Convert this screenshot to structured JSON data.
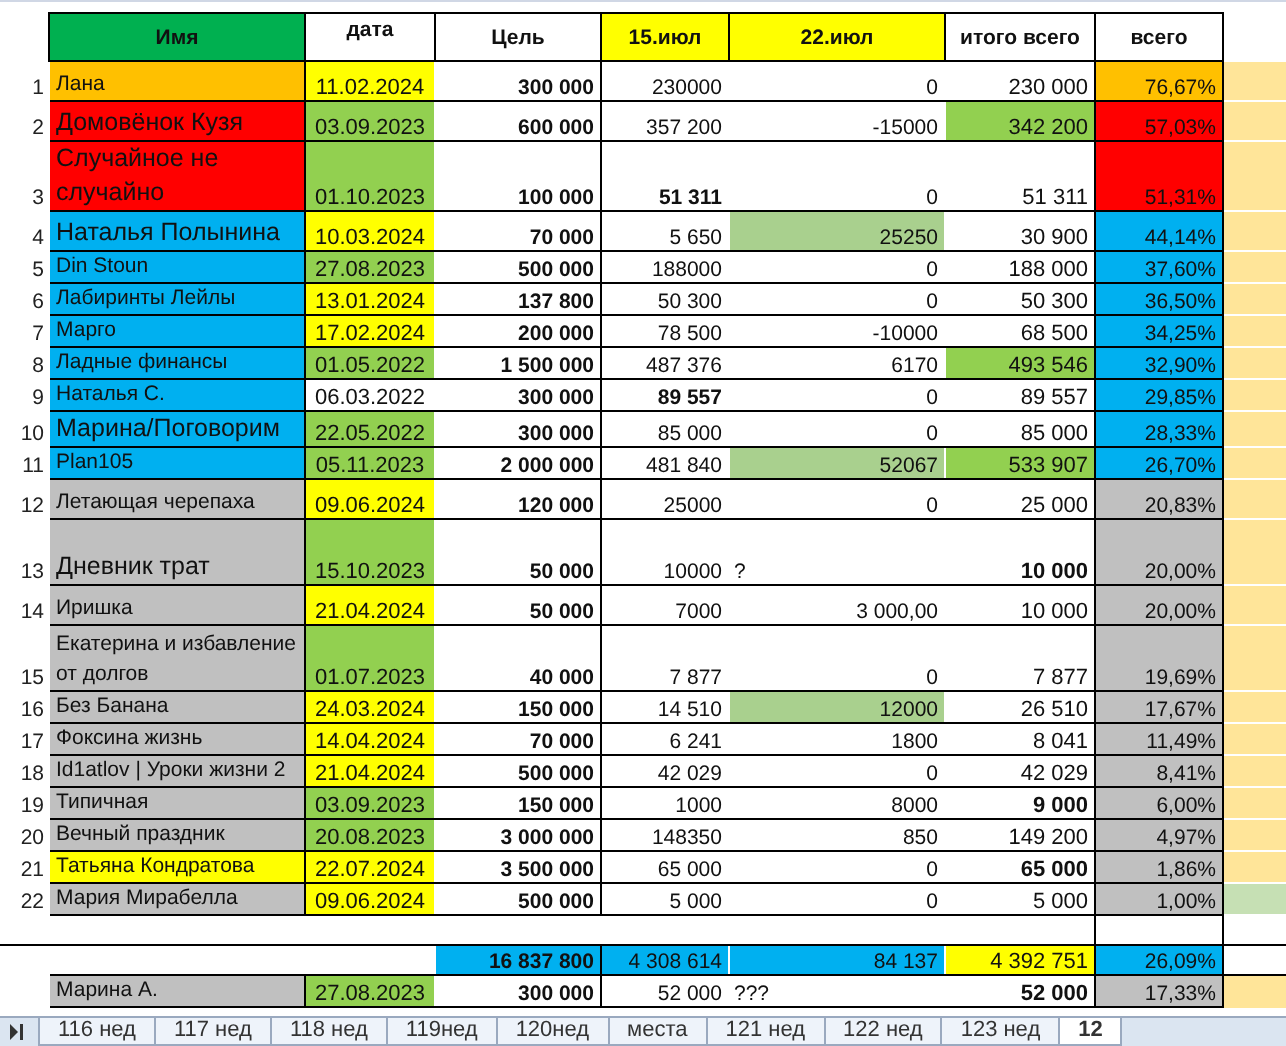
{
  "columns": [
    {
      "label": "Имя",
      "color": "#00b050"
    },
    {
      "label": "дата",
      "color": "#ffffff"
    },
    {
      "label": "Цель",
      "color": "#ffffff"
    },
    {
      "label": "15.июл",
      "color": "#ffff00"
    },
    {
      "label": "22.июл",
      "color": "#ffff00"
    },
    {
      "label": "итого всего",
      "color": "#ffffff"
    },
    {
      "label": "всего",
      "color": "#ffffff"
    }
  ],
  "rows": [
    {
      "num": "1",
      "name": {
        "text": "Лана",
        "color": "#ffc000",
        "large": false
      },
      "date": {
        "text": "11.02.2024",
        "color": "#ffff00"
      },
      "goal": "300 000",
      "w15": {
        "text": "230000",
        "bold": false
      },
      "w22": {
        "text": "0"
      },
      "total": {
        "text": "230 000",
        "bold": false
      },
      "pct": {
        "text": "76,67%",
        "color": "#ffc000"
      },
      "extra": {
        "color": "#ffe599"
      }
    },
    {
      "num": "2",
      "name": {
        "text": "Домовёнок Кузя",
        "color": "#ff0000",
        "large": true
      },
      "date": {
        "text": "03.09.2023",
        "color": "#92d050"
      },
      "goal": "600 000",
      "w15": {
        "text": "357 200",
        "bold": false
      },
      "w22": {
        "text": "-15000"
      },
      "total": {
        "text": "342 200",
        "color": "#92d050",
        "bold": false
      },
      "pct": {
        "text": "57,03%",
        "color": "#ff0000"
      },
      "extra": {
        "color": "#ffe599"
      }
    },
    {
      "num": "3",
      "name": {
        "text": "Случайное не случайно",
        "color": "#ff0000",
        "large": true
      },
      "date": {
        "text": "01.10.2023",
        "color": "#92d050"
      },
      "goal": "100 000",
      "w15": {
        "text": "51 311",
        "bold": true
      },
      "w22": {
        "text": "0"
      },
      "total": {
        "text": "51 311",
        "bold": false
      },
      "pct": {
        "text": "51,31%",
        "color": "#ff0000"
      },
      "extra": {
        "color": "#ffe599"
      }
    },
    {
      "num": "4",
      "name": {
        "text": "Наталья Полынина",
        "color": "#00b0f0",
        "large": true
      },
      "date": {
        "text": "10.03.2024",
        "color": "#ffff00"
      },
      "goal": "70 000",
      "w15": {
        "text": "5 650",
        "bold": false
      },
      "w22": {
        "text": "25250",
        "color": "#a9d08e"
      },
      "total": {
        "text": "30 900",
        "bold": false
      },
      "pct": {
        "text": "44,14%",
        "color": "#00b0f0"
      },
      "extra": {
        "color": "#ffe599"
      }
    },
    {
      "num": "5",
      "name": {
        "text": "Din Stoun",
        "color": "#00b0f0",
        "large": false
      },
      "date": {
        "text": "27.08.2023",
        "color": "#92d050"
      },
      "goal": "500 000",
      "w15": {
        "text": "188000",
        "bold": false
      },
      "w22": {
        "text": "0"
      },
      "total": {
        "text": "188 000",
        "bold": false
      },
      "pct": {
        "text": "37,60%",
        "color": "#00b0f0"
      },
      "extra": {
        "color": "#ffe599"
      }
    },
    {
      "num": "6",
      "name": {
        "text": "Лабиринты Лейлы",
        "color": "#00b0f0",
        "large": false
      },
      "date": {
        "text": "13.01.2024",
        "color": "#ffff00"
      },
      "goal": "137 800",
      "w15": {
        "text": "50 300",
        "bold": false
      },
      "w22": {
        "text": "0"
      },
      "total": {
        "text": "50 300",
        "bold": false
      },
      "pct": {
        "text": "36,50%",
        "color": "#00b0f0"
      },
      "extra": {
        "color": "#ffe599"
      }
    },
    {
      "num": "7",
      "name": {
        "text": "Марго",
        "color": "#00b0f0",
        "large": false
      },
      "date": {
        "text": "17.02.2024",
        "color": "#ffff00"
      },
      "goal": "200 000",
      "w15": {
        "text": "78 500",
        "bold": false
      },
      "w22": {
        "text": "-10000"
      },
      "total": {
        "text": "68 500",
        "bold": false
      },
      "pct": {
        "text": "34,25%",
        "color": "#00b0f0"
      },
      "extra": {
        "color": "#ffe599"
      }
    },
    {
      "num": "8",
      "name": {
        "text": "Ладные финансы",
        "color": "#00b0f0",
        "large": false
      },
      "date": {
        "text": "01.05.2022",
        "color": "#92d050"
      },
      "goal": "1 500 000",
      "w15": {
        "text": "487 376",
        "bold": false
      },
      "w22": {
        "text": "6170"
      },
      "total": {
        "text": "493 546",
        "color": "#92d050",
        "bold": false
      },
      "pct": {
        "text": "32,90%",
        "color": "#00b0f0"
      },
      "extra": {
        "color": "#ffe599"
      }
    },
    {
      "num": "9",
      "name": {
        "text": "Наталья С.",
        "color": "#00b0f0",
        "large": false
      },
      "date": {
        "text": "06.03.2022",
        "color": "#ffffff"
      },
      "goal": "300 000",
      "w15": {
        "text": "89 557",
        "bold": true
      },
      "w22": {
        "text": "0"
      },
      "total": {
        "text": "89 557",
        "bold": false
      },
      "pct": {
        "text": "29,85%",
        "color": "#00b0f0"
      },
      "extra": {
        "color": "#ffe599"
      }
    },
    {
      "num": "10",
      "name": {
        "text": "Марина/Поговорим",
        "color": "#00b0f0",
        "large": true
      },
      "date": {
        "text": "22.05.2022",
        "color": "#92d050"
      },
      "goal": "300 000",
      "w15": {
        "text": "85 000",
        "bold": false
      },
      "w22": {
        "text": "0"
      },
      "total": {
        "text": "85 000",
        "bold": false
      },
      "pct": {
        "text": "28,33%",
        "color": "#00b0f0"
      },
      "extra": {
        "color": "#ffe599"
      }
    },
    {
      "num": "11",
      "name": {
        "text": "Plan105",
        "color": "#00b0f0",
        "large": false
      },
      "date": {
        "text": "05.11.2023",
        "color": "#92d050"
      },
      "goal": "2 000 000",
      "w15": {
        "text": "481 840",
        "bold": false
      },
      "w22": {
        "text": "52067",
        "color": "#a9d08e"
      },
      "total": {
        "text": "533 907",
        "color": "#92d050",
        "bold": false
      },
      "pct": {
        "text": "26,70%",
        "color": "#00b0f0"
      },
      "extra": {
        "color": "#ffe599"
      }
    },
    {
      "num": "12",
      "name": {
        "text": "Летающая черепаха",
        "color": "#c0c0c0",
        "large": false
      },
      "date": {
        "text": "09.06.2024",
        "color": "#ffff00"
      },
      "goal": "120 000",
      "w15": {
        "text": "25000",
        "bold": false
      },
      "w22": {
        "text": "0"
      },
      "total": {
        "text": "25 000",
        "bold": false
      },
      "pct": {
        "text": "20,83%",
        "color": "#c0c0c0"
      },
      "extra": {
        "color": "#ffe599"
      }
    },
    {
      "num": "13",
      "name": {
        "text": "Дневник трат",
        "color": "#c0c0c0",
        "large": true
      },
      "date": {
        "text": "15.10.2023",
        "color": "#92d050"
      },
      "goal": "50 000",
      "w15": {
        "text": "10000",
        "bold": false
      },
      "w22": {
        "note": "?"
      },
      "total": {
        "text": "10 000",
        "bold": true
      },
      "pct": {
        "text": "20,00%",
        "color": "#c0c0c0"
      },
      "extra": {
        "color": "#ffe599"
      }
    },
    {
      "num": "14",
      "name": {
        "text": "Иришка",
        "color": "#c0c0c0",
        "large": false
      },
      "date": {
        "text": "21.04.2024",
        "color": "#ffff00"
      },
      "goal": "50 000",
      "w15": {
        "text": "7000",
        "bold": false
      },
      "w22": {
        "text": "3 000,00"
      },
      "total": {
        "text": "10 000",
        "bold": false
      },
      "pct": {
        "text": "20,00%",
        "color": "#c0c0c0"
      },
      "extra": {
        "color": "#ffe599"
      }
    },
    {
      "num": "15",
      "name": {
        "text": "Екатерина и избавление от долгов",
        "color": "#c0c0c0",
        "large": false
      },
      "date": {
        "text": "01.07.2023",
        "color": "#92d050"
      },
      "goal": "40 000",
      "w15": {
        "text": "7 877",
        "bold": false
      },
      "w22": {
        "text": "0"
      },
      "total": {
        "text": "7 877",
        "bold": false
      },
      "pct": {
        "text": "19,69%",
        "color": "#c0c0c0"
      },
      "extra": {
        "color": "#ffe599"
      }
    },
    {
      "num": "16",
      "name": {
        "text": "Без Банана",
        "color": "#c0c0c0",
        "large": false
      },
      "date": {
        "text": "24.03.2024",
        "color": "#ffff00"
      },
      "goal": "150 000",
      "w15": {
        "text": "14 510",
        "bold": false
      },
      "w22": {
        "text": "12000",
        "color": "#a9d08e"
      },
      "total": {
        "text": "26 510",
        "bold": false
      },
      "pct": {
        "text": "17,67%",
        "color": "#c0c0c0"
      },
      "extra": {
        "color": "#ffe599"
      }
    },
    {
      "num": "17",
      "name": {
        "text": "Фоксина жизнь",
        "color": "#c0c0c0",
        "large": false
      },
      "date": {
        "text": "14.04.2024",
        "color": "#ffff00"
      },
      "goal": "70 000",
      "w15": {
        "text": "6 241",
        "bold": false
      },
      "w22": {
        "text": "1800"
      },
      "total": {
        "text": "8 041",
        "bold": false
      },
      "pct": {
        "text": "11,49%",
        "color": "#c0c0c0"
      },
      "extra": {
        "color": "#ffe599"
      }
    },
    {
      "num": "18",
      "name": {
        "text": "Id1atlov |  Уроки жизни 2",
        "color": "#c0c0c0",
        "large": false
      },
      "date": {
        "text": "21.04.2024",
        "color": "#ffff00"
      },
      "goal": "500 000",
      "w15": {
        "text": "42 029",
        "bold": false
      },
      "w22": {
        "text": "0"
      },
      "total": {
        "text": "42 029",
        "bold": false
      },
      "pct": {
        "text": "8,41%",
        "color": "#c0c0c0"
      },
      "extra": {
        "color": "#ffe599"
      }
    },
    {
      "num": "19",
      "name": {
        "text": "Типичная",
        "color": "#c0c0c0",
        "large": false
      },
      "date": {
        "text": "03.09.2023",
        "color": "#92d050"
      },
      "goal": "150 000",
      "w15": {
        "text": "1000",
        "bold": false
      },
      "w22": {
        "text": "8000"
      },
      "total": {
        "text": "9 000",
        "bold": true
      },
      "pct": {
        "text": "6,00%",
        "color": "#c0c0c0"
      },
      "extra": {
        "color": "#ffe599"
      }
    },
    {
      "num": "20",
      "name": {
        "text": "Вечный праздник",
        "color": "#c0c0c0",
        "large": false
      },
      "date": {
        "text": "20.08.2023",
        "color": "#92d050"
      },
      "goal": "3 000 000",
      "w15": {
        "text": "148350",
        "bold": false
      },
      "w22": {
        "text": "850"
      },
      "total": {
        "text": "149 200",
        "bold": false
      },
      "pct": {
        "text": "4,97%",
        "color": "#c0c0c0"
      },
      "extra": {
        "color": "#ffe599"
      }
    },
    {
      "num": "21",
      "name": {
        "text": "Татьяна Кондратова",
        "color": "#ffff00",
        "large": false
      },
      "date": {
        "text": "22.07.2024",
        "color": "#ffff00"
      },
      "goal": "3 500 000",
      "w15": {
        "text": "65 000",
        "bold": false
      },
      "w22": {
        "text": "0"
      },
      "total": {
        "text": "65 000",
        "bold": true
      },
      "pct": {
        "text": "1,86%",
        "color": "#c0c0c0"
      },
      "extra": {
        "color": "#ffe599"
      }
    },
    {
      "num": "22",
      "name": {
        "text": "Мария Мирабелла",
        "color": "#c0c0c0",
        "large": false
      },
      "date": {
        "text": "09.06.2024",
        "color": "#ffff00"
      },
      "goal": "500 000",
      "w15": {
        "text": "5 000",
        "bold": false
      },
      "w22": {
        "text": "0"
      },
      "total": {
        "text": "5 000",
        "bold": false
      },
      "pct": {
        "text": "1,00%",
        "color": "#c0c0c0"
      },
      "extra": {
        "color": "#c6e0b4"
      }
    }
  ],
  "totals": {
    "goal": "16 837 800",
    "w15": "4 308 614",
    "w22": "84 137",
    "total": "4 392 751",
    "pct": "26,09%"
  },
  "extra_row": {
    "name": {
      "text": "Марина А.",
      "color": "#c0c0c0",
      "large": false
    },
    "date": {
      "text": "27.08.2023",
      "color": "#92d050"
    },
    "goal": "300 000",
    "w15": {
      "text": "52 000",
      "bold": false
    },
    "w22": {
      "note": "???"
    },
    "total": {
      "text": "52 000",
      "bold": true
    },
    "pct": {
      "text": "17,33%",
      "color": "#c0c0c0"
    },
    "extra": {
      "color": "#ffe599"
    }
  },
  "sheet_tabs": [
    {
      "label": "116 нед",
      "selected": false
    },
    {
      "label": "117 нед",
      "selected": false
    },
    {
      "label": "118 нед",
      "selected": false
    },
    {
      "label": "119нед",
      "selected": false
    },
    {
      "label": "120нед",
      "selected": false
    },
    {
      "label": "места",
      "selected": false
    },
    {
      "label": "121 нед",
      "selected": false
    },
    {
      "label": "122 нед",
      "selected": false
    },
    {
      "label": "123 нед",
      "selected": false
    },
    {
      "label": "12",
      "selected": true
    }
  ]
}
